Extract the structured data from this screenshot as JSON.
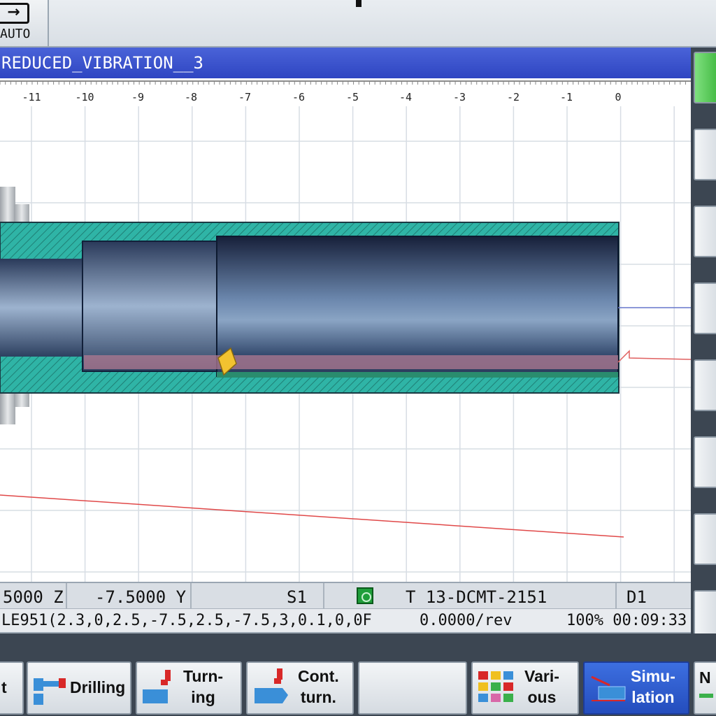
{
  "top": {
    "mode_label": "AUTO",
    "mode_icon": "arrow-right-icon"
  },
  "window": {
    "title": "REDUCED_VIBRATION__3"
  },
  "ruler": {
    "ticks": [
      "-11",
      "-10",
      "-9",
      "-8",
      "-7",
      "-6",
      "-5",
      "-4",
      "-3",
      "-2",
      "-1",
      "0"
    ]
  },
  "status": {
    "x_value": "5000 Z",
    "y_value": "-7.5000 Y",
    "spindle": "S1",
    "tool": "T 13-DCMT-2151",
    "d_number": "D1",
    "program_line": "LE951(2.3,0,2.5,-7.5,2.5,-7.5,3,0.1,0,0F",
    "feed": "0.0000/rev",
    "override_time": "100% 00:09:33"
  },
  "softkeys": [
    {
      "label": "t",
      "icon": "partial-key-icon"
    },
    {
      "label": "Drilling",
      "icon": "drill-icon"
    },
    {
      "label": "Turn-\ning",
      "icon": "turning-icon"
    },
    {
      "label": "Cont.\nturn.",
      "icon": "contour-turning-icon"
    },
    {
      "label": "",
      "icon": ""
    },
    {
      "label": "Vari-\nous",
      "icon": "various-icon"
    },
    {
      "label": "Simu-\nlation",
      "icon": "simulation-icon",
      "active": true
    },
    {
      "label": "N",
      "icon": "partial-key-icon"
    }
  ],
  "colors": {
    "title_bar": "#3550cc",
    "workpiece_wall": "#2fb4a6",
    "active_softkey": "#2f5bd0",
    "tool_insert": "#f2c230"
  }
}
